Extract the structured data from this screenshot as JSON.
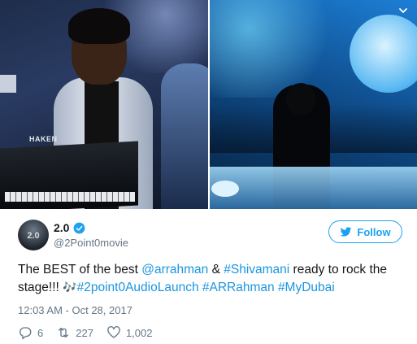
{
  "media": {
    "left_keyboard_brand": "HAKEN"
  },
  "profile": {
    "avatar_text": "2.0",
    "name": "2.0",
    "handle": "@2Point0movie"
  },
  "follow_button": {
    "label": "Follow"
  },
  "tweet": {
    "part1": "The BEST of the best ",
    "mention1": "@arrahman",
    "part2": " & ",
    "hashtag1": "#Shivamani",
    "part3": " ready to rock the stage!!! ",
    "music_emoji": "🎶",
    "hashtag2": "#2point0AudioLaunch",
    "hashtag3": "#ARRahman",
    "hashtag4": "#MyDubai"
  },
  "timestamp": "12:03 AM - Oct 28, 2017",
  "actions": {
    "replies": "6",
    "retweets": "227",
    "likes": "1,002"
  },
  "colors": {
    "link": "#1b95e0",
    "brand_blue": "#1da1f2",
    "secondary_text": "#657786"
  }
}
